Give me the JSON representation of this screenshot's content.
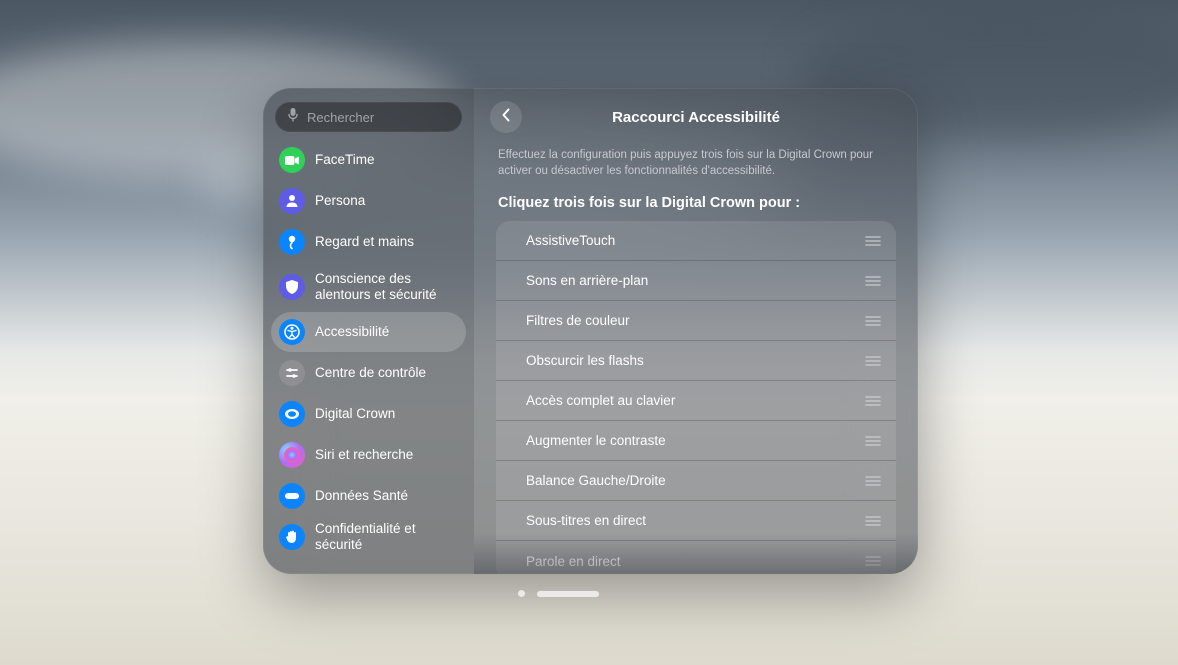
{
  "search": {
    "placeholder": "Rechercher"
  },
  "sidebar": {
    "items": [
      {
        "id": "facetime",
        "label": "FaceTime",
        "color": "#30d158",
        "icon": "video"
      },
      {
        "id": "persona",
        "label": "Persona",
        "color": "#5e5ce6",
        "icon": "persona"
      },
      {
        "id": "regard-mains",
        "label": "Regard et mains",
        "color": "#0a84ff",
        "icon": "hand"
      },
      {
        "id": "conscience",
        "label": "Conscience des alentours et sécurité",
        "color": "#5e5ce6",
        "icon": "shield",
        "tall": true
      },
      {
        "id": "accessibilite",
        "label": "Accessibilité",
        "color": "#0a84ff",
        "icon": "accessibility",
        "selected": true
      },
      {
        "id": "centre-controle",
        "label": "Centre de contrôle",
        "color": "#8e8e93",
        "icon": "sliders"
      },
      {
        "id": "digital-crown",
        "label": "Digital Crown",
        "color": "#0a84ff",
        "icon": "crown"
      },
      {
        "id": "siri-recherche",
        "label": "Siri et recherche",
        "color": "gradient",
        "icon": "siri"
      },
      {
        "id": "donnees-sante",
        "label": "Données Santé",
        "color": "#0a84ff",
        "icon": "health"
      },
      {
        "id": "confidentialite",
        "label": "Confidentialité et sécurité",
        "color": "#0a84ff",
        "icon": "hand-raised"
      }
    ]
  },
  "main": {
    "title": "Raccourci Accessibilité",
    "hint": "Effectuez la configuration puis appuyez trois fois sur la Digital Crown pour activer ou désactiver les fonctionnalités d'accessibilité.",
    "section_title": "Cliquez trois fois sur la Digital Crown pour :",
    "rows": [
      {
        "label": "AssistiveTouch"
      },
      {
        "label": "Sons en arrière-plan"
      },
      {
        "label": "Filtres de couleur"
      },
      {
        "label": "Obscurcir les flashs"
      },
      {
        "label": "Accès complet au clavier"
      },
      {
        "label": "Augmenter le contraste"
      },
      {
        "label": "Balance Gauche/Droite"
      },
      {
        "label": "Sous-titres en direct"
      },
      {
        "label": "Parole en direct"
      }
    ]
  }
}
